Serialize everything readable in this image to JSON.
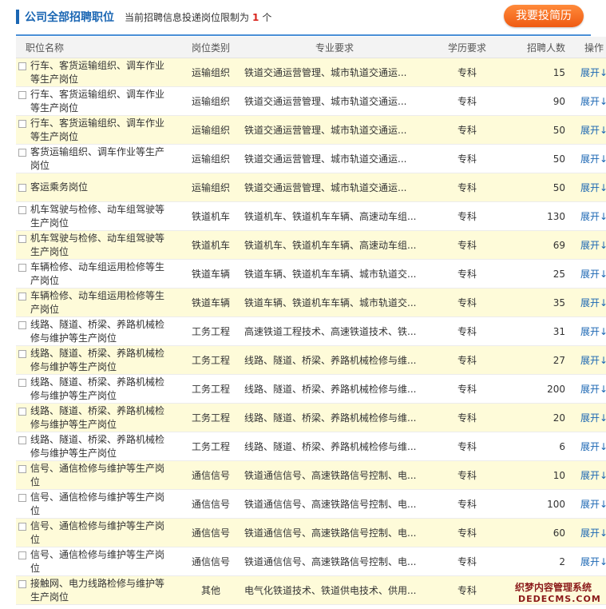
{
  "header": {
    "title": "公司全部招聘职位",
    "notice_prefix": "当前招聘信息投递岗位限制为",
    "notice_count": "1",
    "notice_suffix": "个",
    "apply_button": "我要投简历"
  },
  "table": {
    "columns": [
      "职位名称",
      "岗位类别",
      "专业要求",
      "学历要求",
      "招聘人数",
      "操作"
    ],
    "rows": [
      {
        "name": "行车、客货运输组织、调车作业等生产岗位",
        "category": "运输组织",
        "major": "铁道交通运营管理、城市轨道交通运...",
        "education": "专科",
        "count": "15",
        "action": "展开↓"
      },
      {
        "name": "行车、客货运输组织、调车作业等生产岗位",
        "category": "运输组织",
        "major": "铁道交通运营管理、城市轨道交通运...",
        "education": "专科",
        "count": "90",
        "action": "展开↓"
      },
      {
        "name": "行车、客货运输组织、调车作业等生产岗位",
        "category": "运输组织",
        "major": "铁道交通运营管理、城市轨道交通运...",
        "education": "专科",
        "count": "50",
        "action": "展开↓"
      },
      {
        "name": "客货运输组织、调车作业等生产岗位",
        "category": "运输组织",
        "major": "铁道交通运营管理、城市轨道交通运...",
        "education": "专科",
        "count": "50",
        "action": "展开↓"
      },
      {
        "name": "客运乘务岗位",
        "category": "运输组织",
        "major": "铁道交通运营管理、城市轨道交通运...",
        "education": "专科",
        "count": "50",
        "action": "展开↓"
      },
      {
        "name": "机车驾驶与检修、动车组驾驶等生产岗位",
        "category": "铁道机车",
        "major": "铁道机车、铁道机车车辆、高速动车组...",
        "education": "专科",
        "count": "130",
        "action": "展开↓"
      },
      {
        "name": "机车驾驶与检修、动车组驾驶等生产岗位",
        "category": "铁道机车",
        "major": "铁道机车、铁道机车车辆、高速动车组...",
        "education": "专科",
        "count": "69",
        "action": "展开↓"
      },
      {
        "name": "车辆检修、动车组运用检修等生产岗位",
        "category": "铁道车辆",
        "major": "铁道车辆、铁道机车车辆、城市轨道交...",
        "education": "专科",
        "count": "25",
        "action": "展开↓"
      },
      {
        "name": "车辆检修、动车组运用检修等生产岗位",
        "category": "铁道车辆",
        "major": "铁道车辆、铁道机车车辆、城市轨道交...",
        "education": "专科",
        "count": "35",
        "action": "展开↓"
      },
      {
        "name": "线路、隧道、桥梁、养路机械检修与维护等生产岗位",
        "category": "工务工程",
        "major": "高速铁道工程技术、高速铁道技术、铁...",
        "education": "专科",
        "count": "31",
        "action": "展开↓"
      },
      {
        "name": "线路、隧道、桥梁、养路机械检修与维护等生产岗位",
        "category": "工务工程",
        "major": "线路、隧道、桥梁、养路机械检修与维...",
        "education": "专科",
        "count": "27",
        "action": "展开↓"
      },
      {
        "name": "线路、隧道、桥梁、养路机械检修与维护等生产岗位",
        "category": "工务工程",
        "major": "线路、隧道、桥梁、养路机械检修与维...",
        "education": "专科",
        "count": "200",
        "action": "展开↓"
      },
      {
        "name": "线路、隧道、桥梁、养路机械检修与维护等生产岗位",
        "category": "工务工程",
        "major": "线路、隧道、桥梁、养路机械检修与维...",
        "education": "专科",
        "count": "20",
        "action": "展开↓"
      },
      {
        "name": "线路、隧道、桥梁、养路机械检修与维护等生产岗位",
        "category": "工务工程",
        "major": "线路、隧道、桥梁、养路机械检修与维...",
        "education": "专科",
        "count": "6",
        "action": "展开↓"
      },
      {
        "name": "信号、通信检修与维护等生产岗位",
        "category": "通信信号",
        "major": "铁道通信信号、高速铁路信号控制、电...",
        "education": "专科",
        "count": "10",
        "action": "展开↓"
      },
      {
        "name": "信号、通信检修与维护等生产岗位",
        "category": "通信信号",
        "major": "铁道通信信号、高速铁路信号控制、电...",
        "education": "专科",
        "count": "100",
        "action": "展开↓"
      },
      {
        "name": "信号、通信检修与维护等生产岗位",
        "category": "通信信号",
        "major": "铁道通信信号、高速铁路信号控制、电...",
        "education": "专科",
        "count": "60",
        "action": "展开↓"
      },
      {
        "name": "信号、通信检修与维护等生产岗位",
        "category": "通信信号",
        "major": "铁道通信信号、高速铁路信号控制、电...",
        "education": "专科",
        "count": "2",
        "action": "展开↓"
      },
      {
        "name": "接触网、电力线路检修与维护等生产岗位",
        "category": "其他",
        "major": "电气化铁道技术、铁道供电技术、供用...",
        "education": "专科",
        "count": "",
        "action": ""
      }
    ]
  },
  "watermark": {
    "line1": "织梦内容管理系统",
    "line2": "DEDECMS.COM"
  }
}
